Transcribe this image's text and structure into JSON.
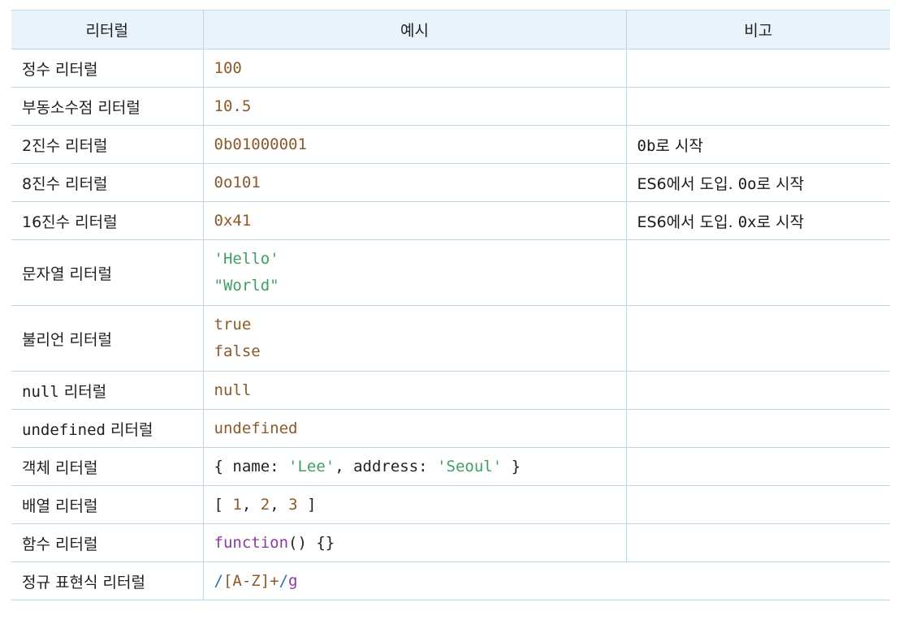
{
  "headers": [
    "리터럴",
    "예시",
    "비고"
  ],
  "rows": [
    {
      "name": "정수 리터럴",
      "example": "100",
      "note": ""
    },
    {
      "name": "부동소수점 리터럴",
      "example": "10.5",
      "note": ""
    },
    {
      "name": "2진수 리터럴",
      "example": "0b01000001",
      "note_code": "0b",
      "note_text": "로 시작"
    },
    {
      "name": "8진수 리터럴",
      "example": "0o101",
      "note_text1": "ES6에서 도입. ",
      "note_code": "0o",
      "note_text": "로 시작"
    },
    {
      "name": "16진수 리터럴",
      "example": "0x41",
      "note_text1": "ES6에서 도입. ",
      "note_code": "0x",
      "note_text": "로 시작"
    },
    {
      "name": "문자열 리터럴",
      "example_lines": [
        "'Hello'",
        "\"World\""
      ]
    },
    {
      "name": "불리언 리터럴",
      "example_lines": [
        "true",
        "false"
      ]
    },
    {
      "name_code": "null",
      "name_text": " 리터럴",
      "example": "null"
    },
    {
      "name_code": "undefined",
      "name_text": " 리터럴",
      "example": "undefined"
    },
    {
      "name": "객체 리터럴",
      "example_parts": [
        "{ name: ",
        "'Lee'",
        ", address: ",
        "'Seoul'",
        " }"
      ]
    },
    {
      "name": "배열 리터럴",
      "example_parts": [
        "[ ",
        "1",
        ", ",
        "2",
        ", ",
        "3",
        " ]"
      ]
    },
    {
      "name": "함수 리터럴",
      "example_parts": [
        "function",
        "() {}"
      ]
    },
    {
      "name": "정규 표현식 리터럴",
      "example_parts": [
        "/",
        "[A-Z]+",
        "/",
        "g"
      ]
    }
  ],
  "colors": {
    "header_bg": "#e9f3fb",
    "border": "#bcd9ea",
    "number": "#8a5a2b",
    "string": "#3f9f66",
    "keyword_function": "#8c3a9e",
    "regex_slash": "#2573b8"
  }
}
